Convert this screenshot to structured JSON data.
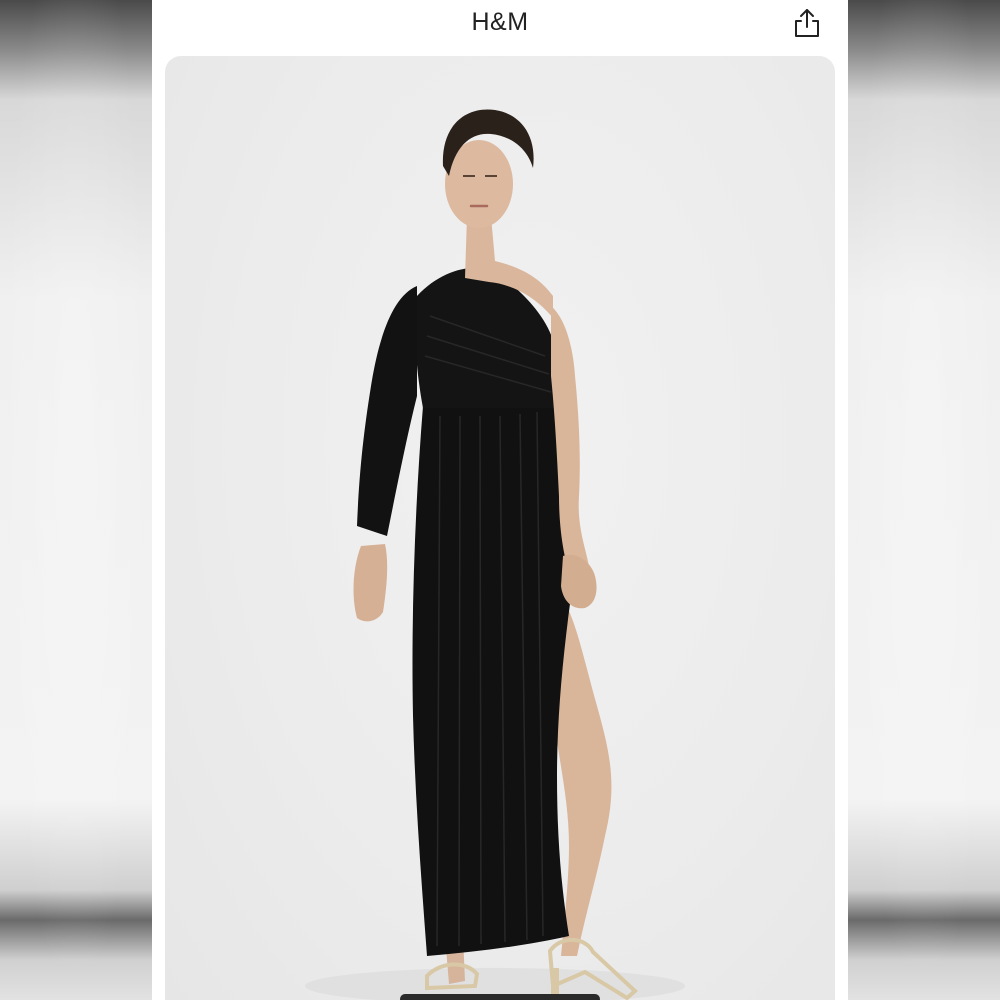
{
  "header": {
    "brand": "H&M",
    "share_icon": "share-icon"
  },
  "product_image": {
    "subject": "model-wearing-black-dress",
    "icon": "product-photo"
  },
  "colors": {
    "background": "#ffffff",
    "photo_backdrop": "#ececec",
    "dress": "#111111",
    "text": "#222222"
  }
}
